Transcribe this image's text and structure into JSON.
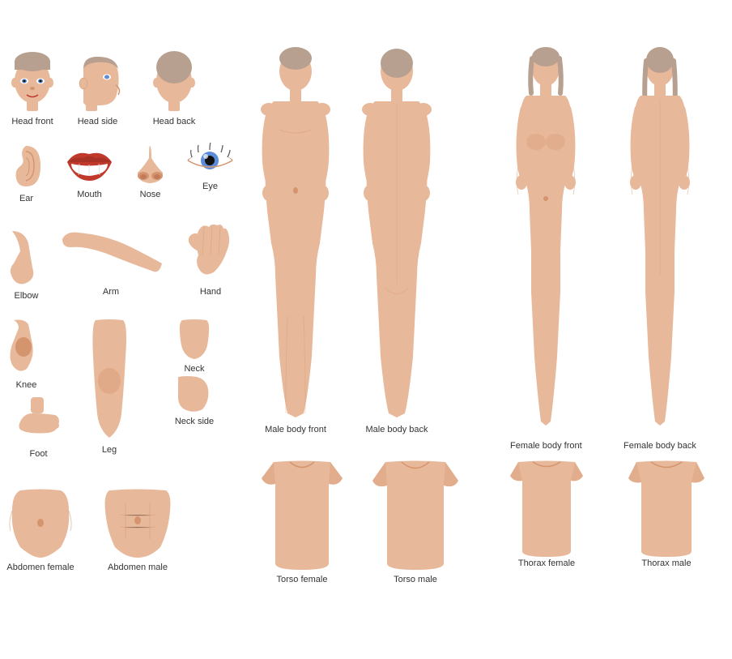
{
  "labels": {
    "head_front": "Head front",
    "head_side": "Head side",
    "head_back": "Head back",
    "ear": "Ear",
    "mouth": "Mouth",
    "nose": "Nose",
    "eye": "Eye",
    "elbow": "Elbow",
    "arm": "Arm",
    "hand": "Hand",
    "knee": "Knee",
    "leg": "Leg",
    "foot": "Foot",
    "neck": "Neck",
    "neck_side": "Neck side",
    "abdomen_female": "Abdomen female",
    "abdomen_male": "Abdomen male",
    "male_body_front": "Male body front",
    "male_body_back": "Male body back",
    "female_body_front": "Female body front",
    "female_body_back": "Female body back",
    "torso_female": "Torso female",
    "torso_male": "Torso male",
    "thorax_female": "Thorax female",
    "thorax_male": "Thorax male"
  },
  "colors": {
    "skin": "#e8b89a",
    "skin_shadow": "#d4956e",
    "hair": "#b8a090",
    "mouth_red": "#c0392b",
    "teeth_white": "#ffffff",
    "eye_blue": "#5b8dd9",
    "background": "#ffffff"
  }
}
